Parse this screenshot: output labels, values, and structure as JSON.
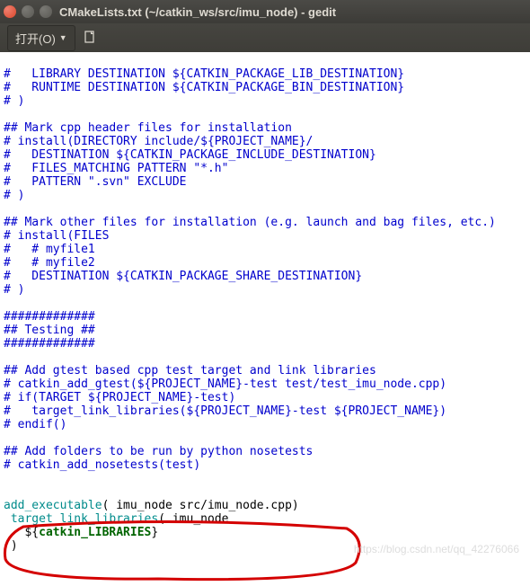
{
  "titlebar": {
    "title": "CMakeLists.txt (~/catkin_ws/src/imu_node) - gedit"
  },
  "toolbar": {
    "open_label": "打开(O)"
  },
  "code": {
    "l01a": "#   LIBRARY DESTINATION ${CATKIN_PACKAGE_LIB_DESTINATION}",
    "l01": "#   RUNTIME DESTINATION ${CATKIN_PACKAGE_BIN_DESTINATION}",
    "l02": "# )",
    "l03": "",
    "l04": "## Mark cpp header files for installation",
    "l05": "# install(DIRECTORY include/${PROJECT_NAME}/",
    "l06": "#   DESTINATION ${CATKIN_PACKAGE_INCLUDE_DESTINATION}",
    "l07": "#   FILES_MATCHING PATTERN \"*.h\"",
    "l08": "#   PATTERN \".svn\" EXCLUDE",
    "l09": "# )",
    "l10": "",
    "l11": "## Mark other files for installation (e.g. launch and bag files, etc.)",
    "l12": "# install(FILES",
    "l13": "#   # myfile1",
    "l14": "#   # myfile2",
    "l15": "#   DESTINATION ${CATKIN_PACKAGE_SHARE_DESTINATION}",
    "l16": "# )",
    "l17": "",
    "l18": "#############",
    "l19": "## Testing ##",
    "l20": "#############",
    "l21": "",
    "l22": "## Add gtest based cpp test target and link libraries",
    "l23": "# catkin_add_gtest(${PROJECT_NAME}-test test/test_imu_node.cpp)",
    "l24": "# if(TARGET ${PROJECT_NAME}-test)",
    "l25": "#   target_link_libraries(${PROJECT_NAME}-test ${PROJECT_NAME})",
    "l26": "# endif()",
    "l27": "",
    "l28": "## Add folders to be run by python nosetests",
    "l29": "# catkin_add_nosetests(test)",
    "l30": "",
    "l31": "",
    "l32_a": "add_executable",
    "l32_b": "( imu_node src/imu_node.cpp)",
    "l33_a": " ",
    "l33_b": "target_link_libraries",
    "l33_c": "( imu_node",
    "l34_a": "   ${",
    "l34_b": "catkin_LIBRARIES",
    "l34_c": "}",
    "l35": " )"
  },
  "watermark": "https://blog.csdn.net/qq_42276066"
}
